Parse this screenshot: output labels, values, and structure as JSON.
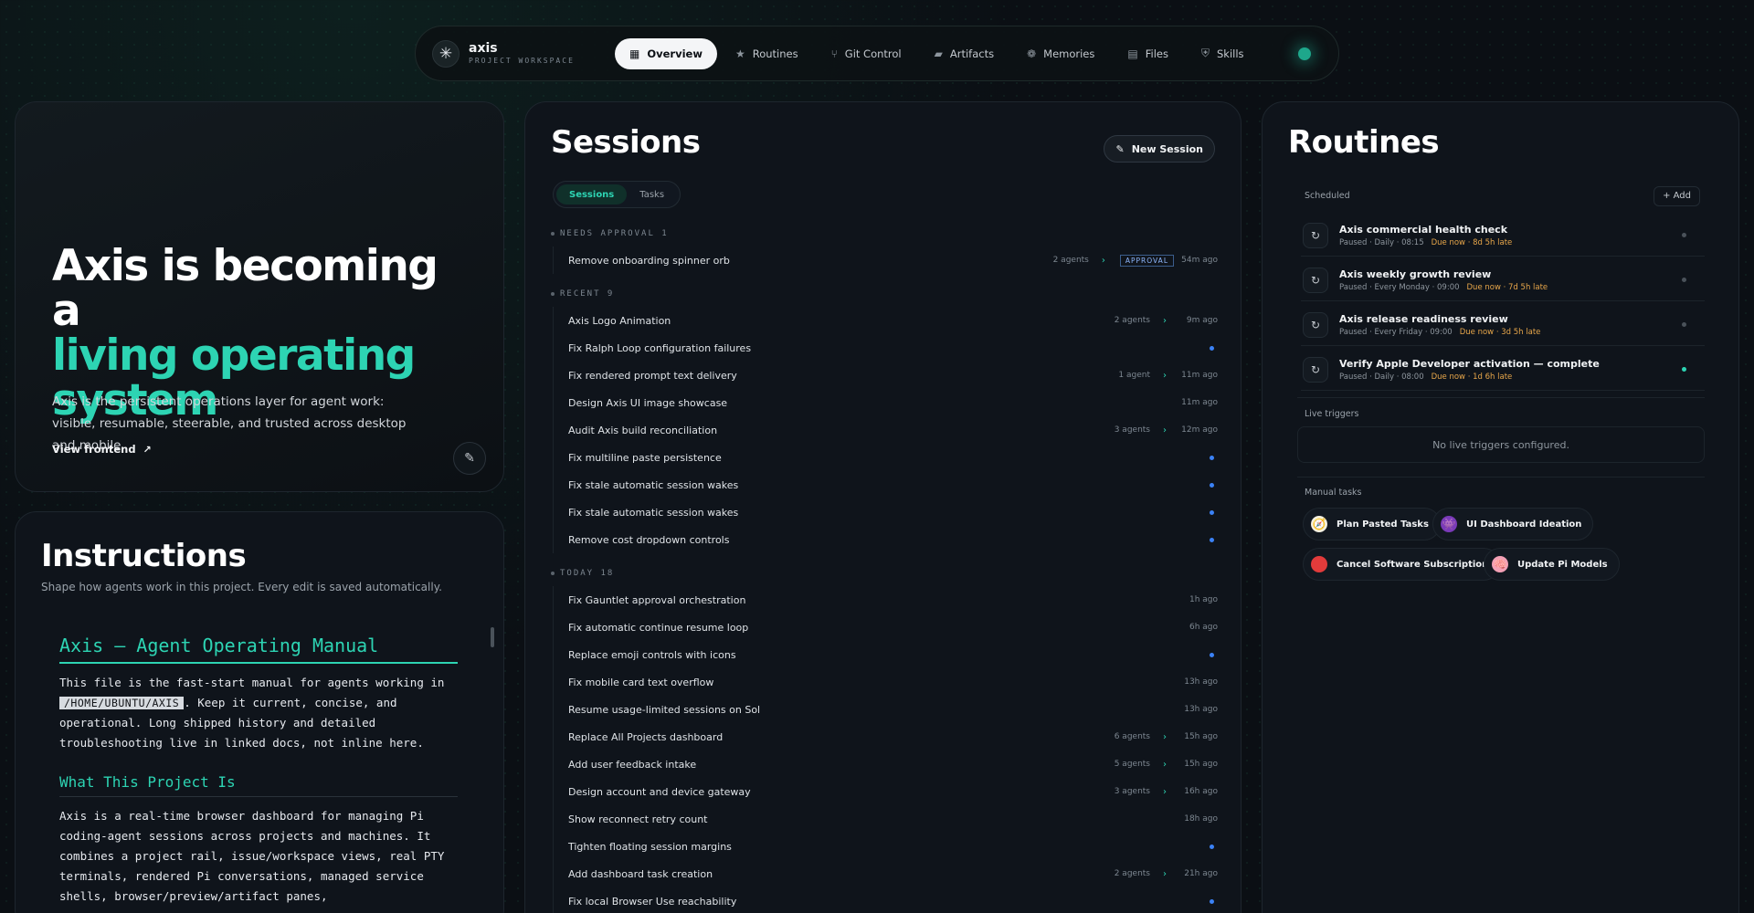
{
  "nav": {
    "brand_name": "axis",
    "brand_sub": "PROJECT WORKSPACE",
    "tabs": [
      {
        "label": "Overview",
        "icon": "grid-icon"
      },
      {
        "label": "Routines",
        "icon": "star-icon"
      },
      {
        "label": "Git Control",
        "icon": "git-branch-icon"
      },
      {
        "label": "Artifacts",
        "icon": "box-icon"
      },
      {
        "label": "Memories",
        "icon": "brain-icon"
      },
      {
        "label": "Files",
        "icon": "file-icon"
      },
      {
        "label": "Skills",
        "icon": "shield-icon"
      }
    ]
  },
  "hero": {
    "title_line1": "Axis is becoming a",
    "title_accent": "living operating system",
    "description": "Axis is the persistent operations layer for agent work: visible, resumable, steerable, and trusted across desktop and mobile.",
    "link": "View frontend"
  },
  "instructions": {
    "title": "Instructions",
    "subtitle": "Shape how agents work in this project. Every edit is saved automatically.",
    "h1": "Axis — Agent Operating Manual",
    "p1_a": "This file is the fast-start manual for agents working in",
    "p1_code": "/HOME/UBUNTU/AXIS",
    "p1_b": ". Keep it current, concise, and operational. Long shipped history and detailed troubleshooting live in linked docs, not inline here.",
    "h2": "What This Project Is",
    "p2": "Axis is a real-time browser dashboard for managing Pi coding-agent sessions across projects and machines. It combines a project rail, issue/workspace views, real PTY terminals, rendered Pi conversations, managed service shells, browser/preview/artifact panes,"
  },
  "sessions": {
    "title": "Sessions",
    "new_button": "New Session",
    "seg_sessions": "Sessions",
    "seg_tasks": "Tasks",
    "groups": [
      {
        "header": "NEEDS APPROVAL  1",
        "rows": [
          {
            "title": "Remove onboarding spinner orb",
            "agents": "2 agents",
            "badge": "APPROVAL",
            "time": "54m ago"
          }
        ]
      },
      {
        "header": "RECENT  9",
        "rows": [
          {
            "title": "Axis Logo Animation",
            "agents": "2 agents",
            "time": "9m ago"
          },
          {
            "title": "Fix Ralph Loop configuration failures",
            "dot": true
          },
          {
            "title": "Fix rendered prompt text delivery",
            "agents": "1 agent",
            "time": "11m ago"
          },
          {
            "title": "Design Axis UI image showcase",
            "time": "11m ago"
          },
          {
            "title": "Audit Axis build reconciliation",
            "agents": "3 agents",
            "time": "12m ago"
          },
          {
            "title": "Fix multiline paste persistence",
            "dot": true
          },
          {
            "title": "Fix stale automatic session wakes",
            "dot": true
          },
          {
            "title": "Fix stale automatic session wakes",
            "dot": true
          },
          {
            "title": "Remove cost dropdown controls",
            "dot": true
          }
        ]
      },
      {
        "header": "TODAY  18",
        "rows": [
          {
            "title": "Fix Gauntlet approval orchestration",
            "time": "1h ago"
          },
          {
            "title": "Fix automatic continue resume loop",
            "time": "6h ago"
          },
          {
            "title": "Replace emoji controls with icons",
            "dot": true
          },
          {
            "title": "Fix mobile card text overflow",
            "time": "13h ago"
          },
          {
            "title": "Resume usage-limited sessions on Sol",
            "time": "13h ago"
          },
          {
            "title": "Replace All Projects dashboard",
            "agents": "6 agents",
            "time": "15h ago"
          },
          {
            "title": "Add user feedback intake",
            "agents": "5 agents",
            "time": "15h ago"
          },
          {
            "title": "Design account and device gateway",
            "agents": "3 agents",
            "time": "16h ago"
          },
          {
            "title": "Show reconnect retry count",
            "time": "18h ago"
          },
          {
            "title": "Tighten floating session margins",
            "dot": true
          },
          {
            "title": "Add dashboard task creation",
            "agents": "2 agents",
            "time": "21h ago"
          },
          {
            "title": "Fix local Browser Use reachability",
            "dot": true
          }
        ]
      }
    ]
  },
  "routines": {
    "title": "Routines",
    "scheduled_label": "Scheduled",
    "add_button": "+ Add",
    "items": [
      {
        "title": "Axis commercial health check",
        "sub": "Paused · Daily · 08:15",
        "late": "Due now · 8d 5h late",
        "active": false
      },
      {
        "title": "Axis weekly growth review",
        "sub": "Paused · Every Monday · 09:00",
        "late": "Due now · 7d 5h late",
        "active": false
      },
      {
        "title": "Axis release readiness review",
        "sub": "Paused · Every Friday · 09:00",
        "late": "Due now · 3d 5h late",
        "active": false
      },
      {
        "title": "Verify Apple Developer activation — complete",
        "sub": "Paused · Daily · 08:00",
        "late": "Due now · 1d 6h late",
        "active": true
      }
    ],
    "live_label": "Live triggers",
    "live_empty": "No live triggers configured.",
    "manual_label": "Manual tasks",
    "manual": [
      {
        "label": "Plan Pasted Tasks",
        "icon": "compass-icon",
        "glyph": "🧭",
        "color": "#f4f0e0"
      },
      {
        "label": "UI Dashboard Ideation",
        "icon": "palette-icon",
        "glyph": "👾",
        "color": "#7a3ab8"
      },
      {
        "label": "Cancel Software Subscription",
        "icon": "red-circle-icon",
        "glyph": "",
        "color": "#e23b3b"
      },
      {
        "label": "Update Pi Models",
        "icon": "brain-icon",
        "glyph": "🧠",
        "color": "#f3a0b5"
      }
    ]
  }
}
